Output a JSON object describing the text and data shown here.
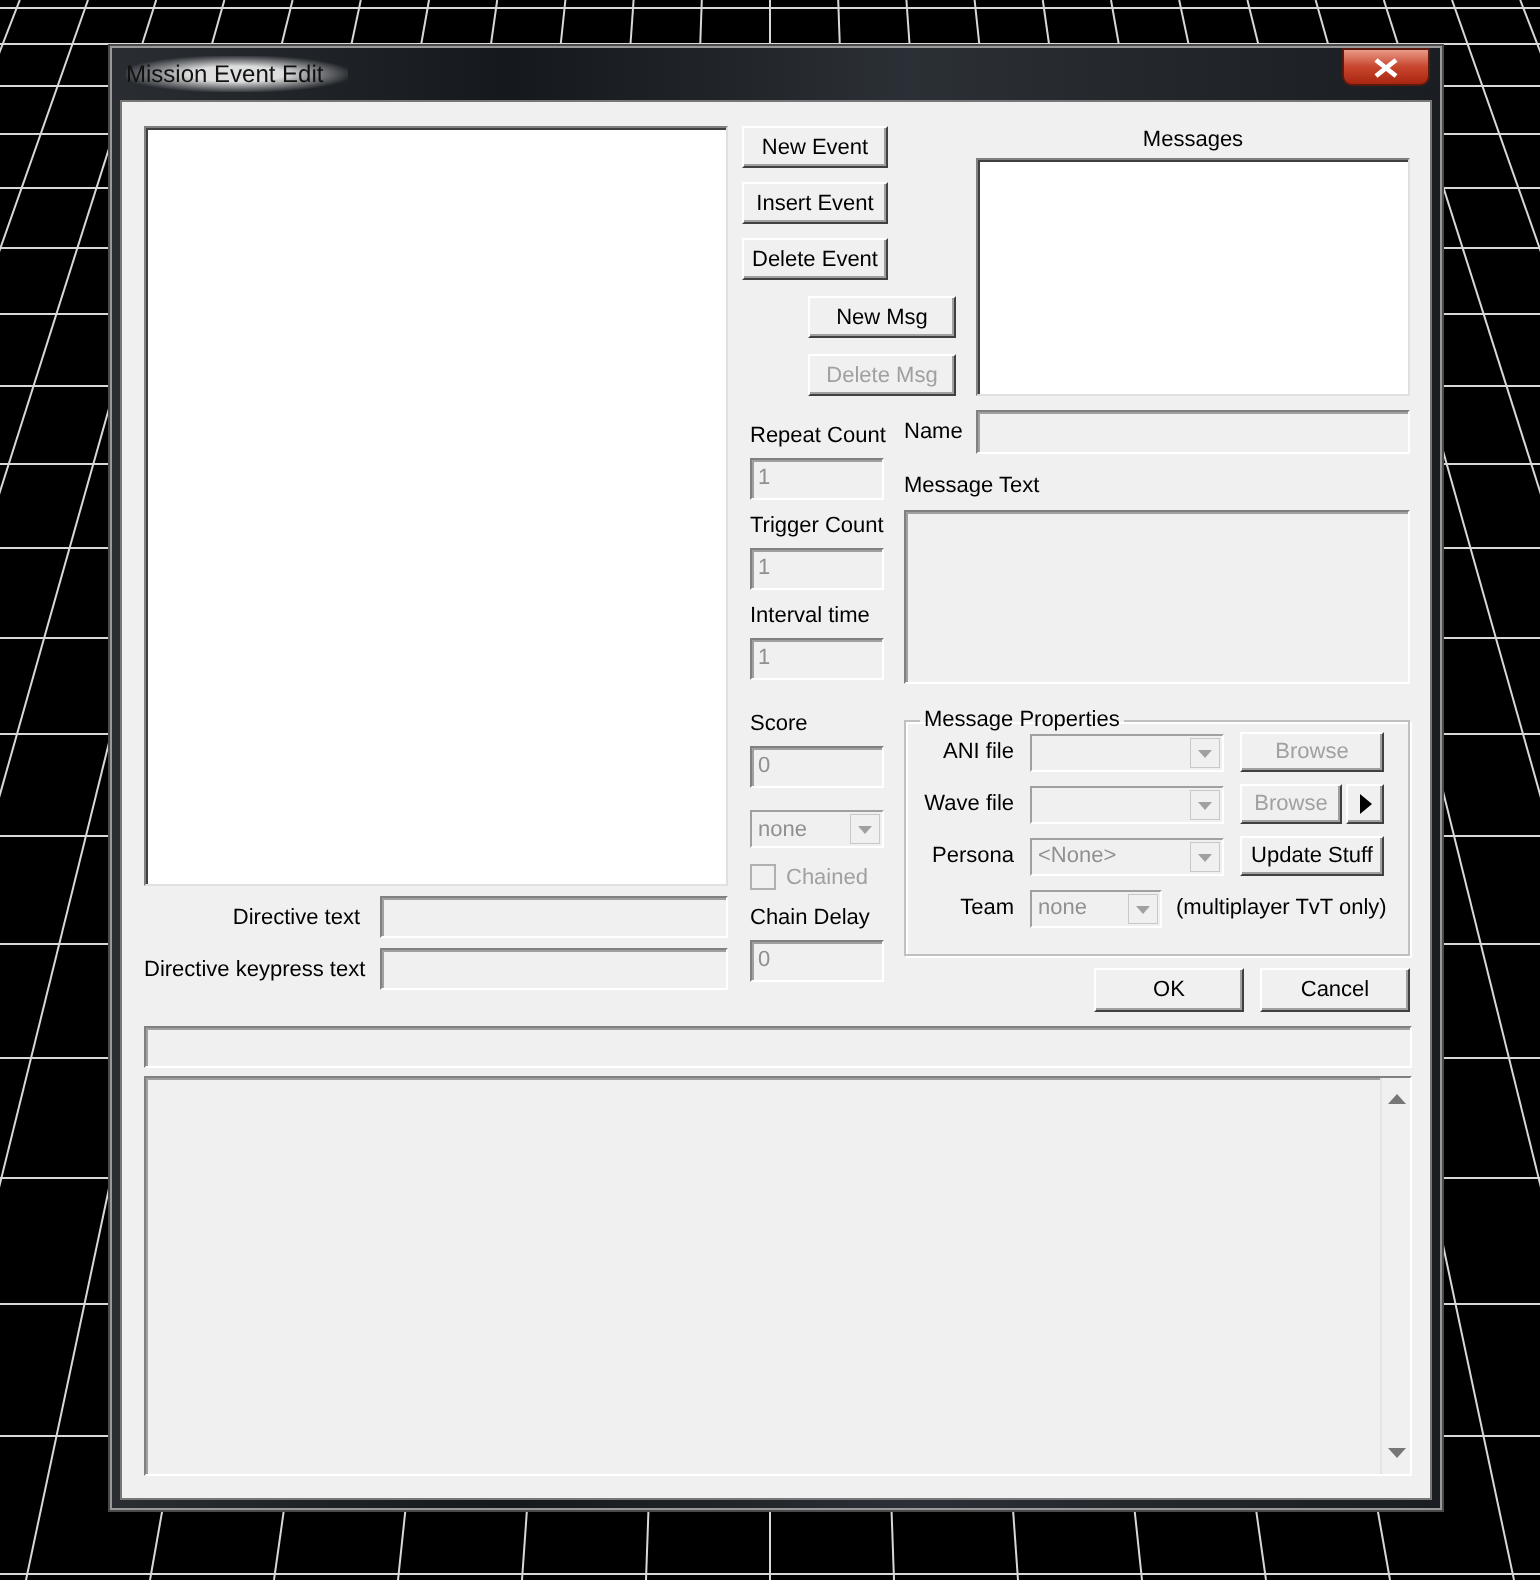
{
  "window": {
    "title": "Mission Event Edit"
  },
  "event_buttons": [
    {
      "label": "New Event",
      "disabled": false
    },
    {
      "label": "Insert Event",
      "disabled": false
    },
    {
      "label": "Delete Event",
      "disabled": false
    }
  ],
  "message_buttons": [
    {
      "label": "New Msg",
      "disabled": false
    },
    {
      "label": "Delete Msg",
      "disabled": true
    }
  ],
  "messages": {
    "label": "Messages"
  },
  "event_fields": [
    {
      "label": "Repeat Count",
      "value": "1",
      "disabled": true
    },
    {
      "label": "Trigger Count",
      "value": "1",
      "disabled": true
    },
    {
      "label": "Interval time",
      "value": "1",
      "disabled": true
    },
    {
      "label": "Score",
      "value": "0",
      "disabled": true
    }
  ],
  "team_select": {
    "value": "none",
    "disabled": true
  },
  "chained": {
    "label": "Chained",
    "checked": false,
    "disabled": true
  },
  "chain_delay": {
    "label": "Chain Delay",
    "value": "0",
    "disabled": true
  },
  "name_field": {
    "label": "Name"
  },
  "message_text": {
    "label": "Message Text"
  },
  "message_properties": {
    "title": "Message Properties",
    "rows": [
      {
        "kind": "file",
        "label": "ANI file",
        "button": "Browse",
        "button_disabled": true,
        "play": false
      },
      {
        "kind": "file",
        "label": "Wave file",
        "button": "Browse",
        "button_disabled": true,
        "play": true
      },
      {
        "kind": "select",
        "label": "Persona",
        "value": "<None>",
        "button": "Update Stuff",
        "button_disabled": false
      },
      {
        "kind": "team",
        "label": "Team",
        "value": "none",
        "note": "(multiplayer TvT only)"
      }
    ]
  },
  "directive_fields": [
    {
      "label": "Directive text"
    },
    {
      "label": "Directive keypress text"
    }
  ],
  "dialog_buttons": [
    {
      "label": "OK"
    },
    {
      "label": "Cancel"
    }
  ]
}
